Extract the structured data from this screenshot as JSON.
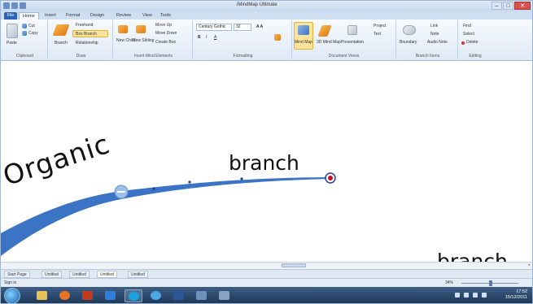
{
  "window": {
    "title": "iMindMap Ultimate",
    "controls": [
      "–",
      "□",
      "✕"
    ]
  },
  "ribbon_tabs": [
    {
      "label": "File",
      "active": false
    },
    {
      "label": "Home",
      "active": true
    },
    {
      "label": "Insert",
      "active": false
    },
    {
      "label": "Format",
      "active": false
    },
    {
      "label": "Design",
      "active": false
    },
    {
      "label": "Review",
      "active": false
    },
    {
      "label": "View",
      "active": false
    },
    {
      "label": "Tools",
      "active": false
    }
  ],
  "ribbon": {
    "clipboard": {
      "paste": "Paste",
      "cut": "Cut",
      "copy": "Copy",
      "label": "Clipboard"
    },
    "draw": {
      "branch": "Branch",
      "freehand": "Freehand",
      "box_branch": "Box Branch",
      "relationship": "Relationship",
      "label": "Draw"
    },
    "insert": {
      "new_child": "New Child",
      "new_sibling": "New Sibling",
      "move_up": "Move Up",
      "move_down": "Move Down",
      "create_box": "Create Box",
      "label": "Insert Mind Elements"
    },
    "formatting": {
      "font": "Century Gothic",
      "size": "32",
      "label": "Formatting"
    },
    "views": {
      "mind_map": "Mind Map",
      "mind_map_3d": "3D Mind Map",
      "presentation": "Presentation",
      "project": "Project",
      "text": "Text",
      "label": "Document Views"
    },
    "branch_items": {
      "boundary": "Boundary",
      "link": "Link",
      "note": "Note",
      "audio_note": "Audio Note",
      "label": "Branch Items"
    },
    "editing": {
      "find": "Find",
      "select": "Select",
      "delete": "Delete",
      "label": "Editing"
    }
  },
  "canvas": {
    "central": "Organic",
    "branch1": "branch",
    "branch2": "branch"
  },
  "doc_tabs": [
    {
      "label": "Start Page",
      "active": false
    },
    {
      "label": "Untitled",
      "active": false
    },
    {
      "label": "Untitled",
      "active": false
    },
    {
      "label": "Untitled",
      "active": true
    },
    {
      "label": "Untitled",
      "active": false
    }
  ],
  "status": {
    "signin": "Sign in",
    "zoom": "34%"
  },
  "taskbar": {
    "time": "17:52",
    "date": "15/12/2011"
  },
  "colors": {
    "accent": "#2d63b6",
    "branch": "#3b74c4",
    "node": "#8fb7e8",
    "endpoint": "#c8102e"
  }
}
